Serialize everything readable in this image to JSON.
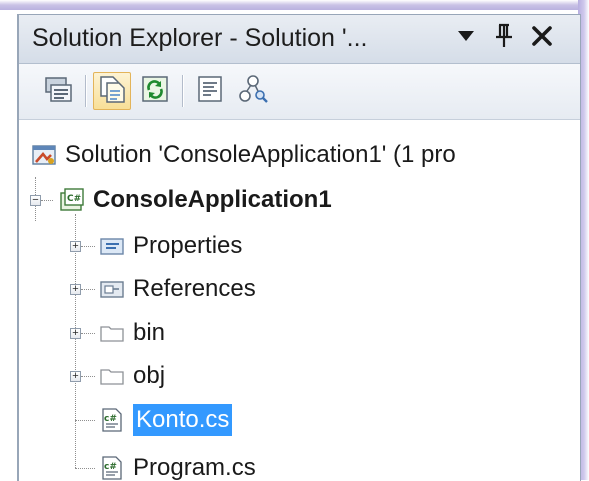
{
  "window": {
    "title": "Solution Explorer - Solution '...",
    "dropdown_icon": "triangle-down-icon",
    "pin_icon": "pin-icon",
    "close_icon": "close-icon"
  },
  "toolbar": {
    "buttons": [
      {
        "name": "properties-button",
        "icon": "properties-window-icon"
      },
      {
        "name": "show-all-files-button",
        "icon": "show-all-files-icon",
        "active": true
      },
      {
        "name": "refresh-button",
        "icon": "refresh-icon"
      },
      {
        "name": "view-code-button",
        "icon": "view-code-icon"
      },
      {
        "name": "view-class-diagram-button",
        "icon": "class-diagram-icon"
      }
    ]
  },
  "tree": {
    "solution": {
      "label": "Solution 'ConsoleApplication1' (1 pro",
      "icon": "solution-icon"
    },
    "project": {
      "label": "ConsoleApplication1",
      "icon": "csharp-project-icon",
      "expanded": true
    },
    "items": [
      {
        "label": "Properties",
        "icon": "properties-folder-icon",
        "expandable": true
      },
      {
        "label": "References",
        "icon": "references-folder-icon",
        "expandable": true
      },
      {
        "label": "bin",
        "icon": "folder-icon",
        "expandable": true
      },
      {
        "label": "obj",
        "icon": "folder-icon",
        "expandable": true
      },
      {
        "label": "Konto.cs",
        "icon": "csharp-file-icon",
        "expandable": false,
        "selected": true
      },
      {
        "label": "Program.cs",
        "icon": "csharp-file-icon",
        "expandable": false
      }
    ]
  },
  "colors": {
    "selection": "#3399ff",
    "glow": "#b9b1df",
    "panel_border": "#98a6b8"
  }
}
